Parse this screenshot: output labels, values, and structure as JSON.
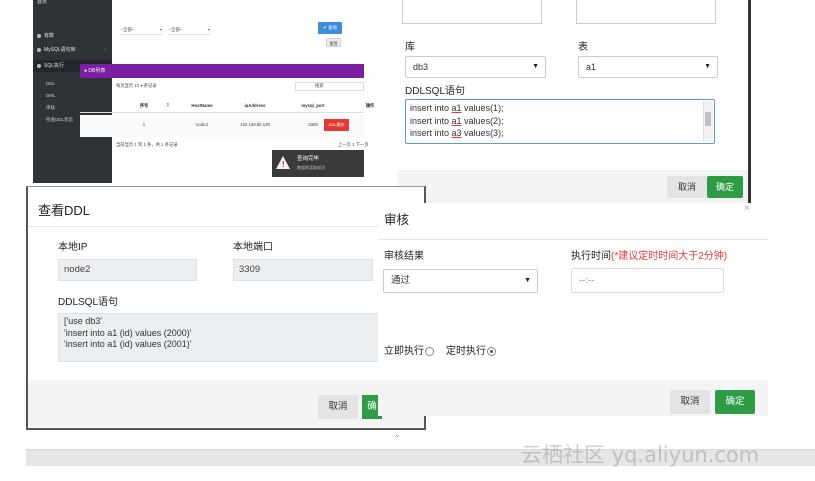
{
  "admin": {
    "sidebar": {
      "top_item": "首页",
      "item_1": "有数",
      "item_2": "MySQL语句库",
      "item_3": "SQL执行",
      "sub_items": [
        "DDL",
        "DML",
        "审核",
        "检查DDL状态"
      ]
    },
    "filters": {
      "select_1": "--全部--",
      "select_2": "--全部--"
    },
    "query_button": "✔ 查询",
    "reset_button": "重置",
    "db_list_title": "DB列表",
    "page_size_label": "每页显示",
    "page_size_value": "10",
    "page_size_suffix": "条记录",
    "search_label": "搜索",
    "table": {
      "columns": [
        "序号",
        "HostName",
        "ipAddress",
        "mysql_port",
        "操作"
      ],
      "rows": [
        {
          "index": "1",
          "host": "node2",
          "ip": "192.168.80.130",
          "port": "3309",
          "action": "DDL操作"
        }
      ]
    },
    "footer_info": "当前显示 1 到 1 条，共 1 条记录",
    "pager": {
      "prev": "上一页",
      "page": "1",
      "next": "下一页"
    },
    "toast": {
      "title": "查询完毕",
      "subtitle": "数据库读取成功"
    }
  },
  "ddl_dialog": {
    "db_label": "库",
    "db_value": "db3",
    "table_label": "表",
    "table_value": "a1",
    "sql_label": "DDLSQL语句",
    "sql_lines": [
      {
        "pre": "insert into ",
        "u": "a1",
        "post": " values(1);"
      },
      {
        "pre": "insert into ",
        "u": "a1",
        "post": " values(2);"
      },
      {
        "pre": "insert into ",
        "u": "a3",
        "post": " values(3);"
      }
    ],
    "cancel": "取消",
    "ok": "确定"
  },
  "view_ddl": {
    "title": "查看DDL",
    "ip_label": "本地IP",
    "ip_value": "node2",
    "port_label": "本地端口",
    "port_value": "3309",
    "sql_label": "DDLSQL语句",
    "sql_lines": [
      "['use db3'",
      " 'insert into a1 (id) values (2000)'",
      " 'insert into a1 (id) values (2001)'"
    ],
    "cancel": "取消",
    "ok": "确"
  },
  "audit": {
    "title": "审核",
    "close": "×",
    "result_label": "审核结果",
    "result_value": "通过",
    "time_label": "执行时间",
    "time_hint": "(*建议定时时间大于2分钟)",
    "time_value": "--:--",
    "immediate_label": "立即执行",
    "scheduled_label": "定时执行",
    "cancel": "取消",
    "ok": "确定"
  },
  "watermark": "云栖社区 yq.aliyun.com",
  "colors": {
    "green": "#2e9c44",
    "purple": "#7b1fa2",
    "blue": "#3d8fdd",
    "red": "#e53935"
  }
}
